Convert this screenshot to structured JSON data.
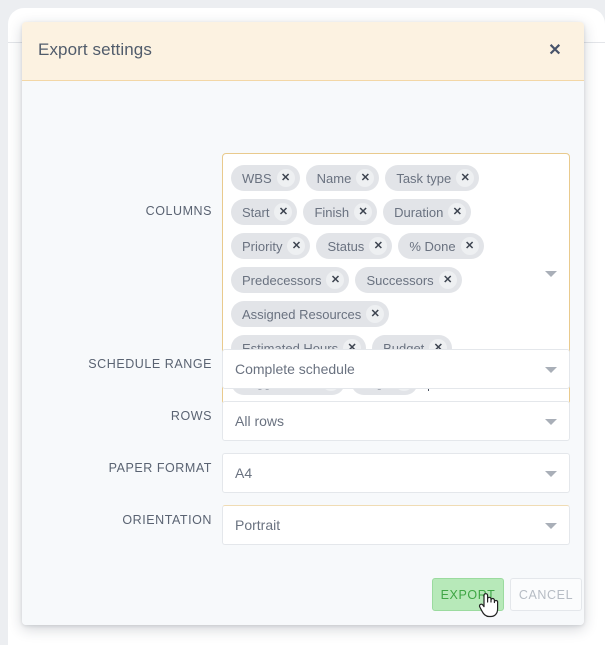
{
  "dialog": {
    "title": "Export settings",
    "close_icon": "close-icon"
  },
  "form": {
    "columns": {
      "label": "COLUMNS",
      "caret_icon": "chevron-down-icon",
      "chips": [
        [
          {
            "label": "WBS",
            "remove_icon": "close-icon",
            "remove_glyph": "✕"
          },
          {
            "label": "Name",
            "remove_icon": "close-icon",
            "remove_glyph": "✕"
          },
          {
            "label": "Task type",
            "remove_icon": "close-icon",
            "remove_glyph": "✕"
          }
        ],
        [
          {
            "label": "Start",
            "remove_icon": "close-icon",
            "remove_glyph": "✕"
          },
          {
            "label": "Finish",
            "remove_icon": "close-icon",
            "remove_glyph": "✕"
          },
          {
            "label": "Duration",
            "remove_icon": "close-icon",
            "remove_glyph": "✕"
          }
        ],
        [
          {
            "label": "Priority",
            "remove_icon": "close-icon",
            "remove_glyph": "✕"
          },
          {
            "label": "Status",
            "remove_icon": "close-icon",
            "remove_glyph": "✕"
          },
          {
            "label": "% Done",
            "remove_icon": "close-icon",
            "remove_glyph": "✕"
          }
        ],
        [
          {
            "label": "Predecessors",
            "remove_icon": "close-icon",
            "remove_glyph": "✕"
          },
          {
            "label": "Successors",
            "remove_icon": "close-icon",
            "remove_glyph": "✕"
          }
        ],
        [
          {
            "label": "Assigned Resources",
            "remove_icon": "close-icon",
            "remove_glyph": "✕"
          }
        ],
        [
          {
            "label": "Estimated Hours",
            "remove_icon": "close-icon",
            "remove_glyph": "✕"
          },
          {
            "label": "Budget",
            "remove_icon": "close-icon",
            "remove_glyph": "✕"
          }
        ],
        [
          {
            "label": "Logged Time",
            "remove_icon": "close-icon",
            "remove_glyph": "✕"
          },
          {
            "label": "Tags",
            "remove_icon": "close-icon",
            "remove_glyph": "✕"
          }
        ]
      ]
    },
    "schedule_range": {
      "label": "SCHEDULE RANGE",
      "value": "Complete schedule",
      "caret_icon": "chevron-down-icon"
    },
    "rows": {
      "label": "ROWS",
      "value": "All rows",
      "caret_icon": "chevron-down-icon"
    },
    "paper_format": {
      "label": "PAPER FORMAT",
      "value": "A4",
      "caret_icon": "chevron-down-icon"
    },
    "orientation": {
      "label": "ORIENTATION",
      "value": "Portrait",
      "caret_icon": "chevron-down-icon"
    }
  },
  "footer": {
    "export_label": "EXPORT",
    "cancel_label": "CANCEL"
  },
  "colors": {
    "header_bg": "#fcf2e1",
    "header_border": "#f3d7a6",
    "body_bg": "#f7f9fb",
    "chip_bg": "#e2e4e8",
    "field_focus_border": "#e9ca8d",
    "export_bg": "#b7e9b9",
    "export_text": "#3fa645",
    "cancel_text": "#b6bcc4",
    "progress_line": "#d8f0dc"
  }
}
